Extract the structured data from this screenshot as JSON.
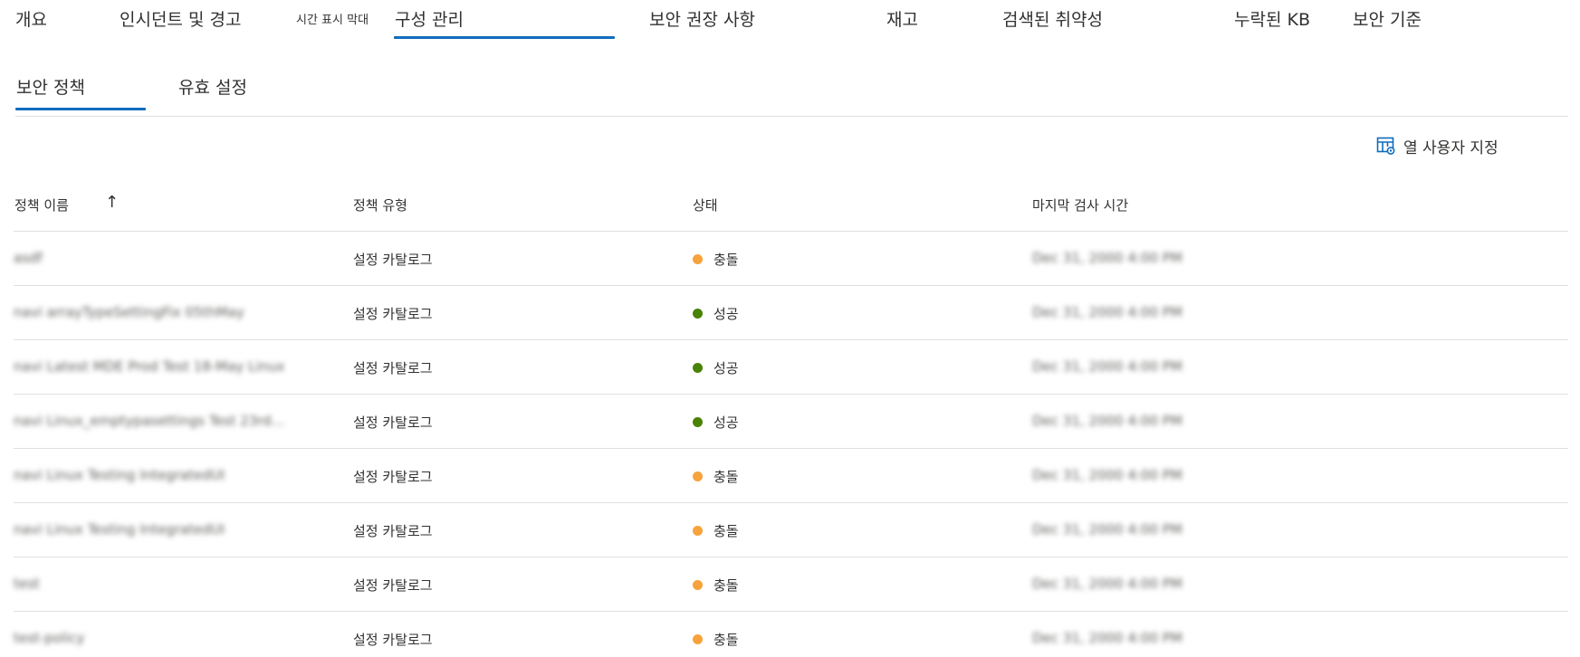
{
  "top_tabs": [
    {
      "label": "개요"
    },
    {
      "label": "인시던트 및 경고"
    },
    {
      "label": "시간 표시 막대"
    },
    {
      "label": "구성 관리",
      "selected": true
    },
    {
      "label": "보안 권장 사항"
    },
    {
      "label": "재고"
    },
    {
      "label": "검색된 취약성"
    },
    {
      "label": "누락된 KB"
    },
    {
      "label": "보안 기준"
    }
  ],
  "sub_tabs": [
    {
      "label": "보안 정책",
      "selected": true
    },
    {
      "label": "유효 설정"
    }
  ],
  "toolbar": {
    "customize_label": "열 사용자 지정",
    "customize_icon": "table-settings-icon"
  },
  "table": {
    "columns": [
      "정책 이름",
      "정책 유형",
      "상태",
      "마지막 검사 시간"
    ],
    "sort_indicator": "↑",
    "rows": [
      {
        "name": "asdf",
        "type": "설정 카탈로그",
        "status": "충돌",
        "status_color": "#f7a23c",
        "last_check": "Dec 31, 2000 4:00 PM"
      },
      {
        "name": "navi arrayTypeSettingFix 05thMay",
        "type": "설정 카탈로그",
        "status": "성공",
        "status_color": "#498205",
        "last_check": "Dec 31, 2000 4:00 PM"
      },
      {
        "name": "navi Latest MDE Prod Test 18-May Linux",
        "type": "설정 카탈로그",
        "status": "성공",
        "status_color": "#498205",
        "last_check": "Dec 31, 2000 4:00 PM"
      },
      {
        "name": "navi Linux_emptypasettings Test 23rd...",
        "type": "설정 카탈로그",
        "status": "성공",
        "status_color": "#498205",
        "last_check": "Dec 31, 2000 4:00 PM"
      },
      {
        "name": "navi Linux Testing IntegratedUI",
        "type": "설정 카탈로그",
        "status": "충돌",
        "status_color": "#f7a23c",
        "last_check": "Dec 31, 2000 4:00 PM"
      },
      {
        "name": "navi Linux Testing IntegratedUI",
        "type": "설정 카탈로그",
        "status": "충돌",
        "status_color": "#f7a23c",
        "last_check": "Dec 31, 2000 4:00 PM"
      },
      {
        "name": "test",
        "type": "설정 카탈로그",
        "status": "충돌",
        "status_color": "#f7a23c",
        "last_check": "Dec 31, 2000 4:00 PM"
      },
      {
        "name": "test-policy",
        "type": "설정 카탈로그",
        "status": "충돌",
        "status_color": "#f7a23c",
        "last_check": "Dec 31, 2000 4:00 PM"
      }
    ]
  },
  "colors": {
    "accent": "#0f6cbd",
    "divider": "#e1dfdd",
    "conflict": "#f7a23c",
    "success": "#498205"
  }
}
